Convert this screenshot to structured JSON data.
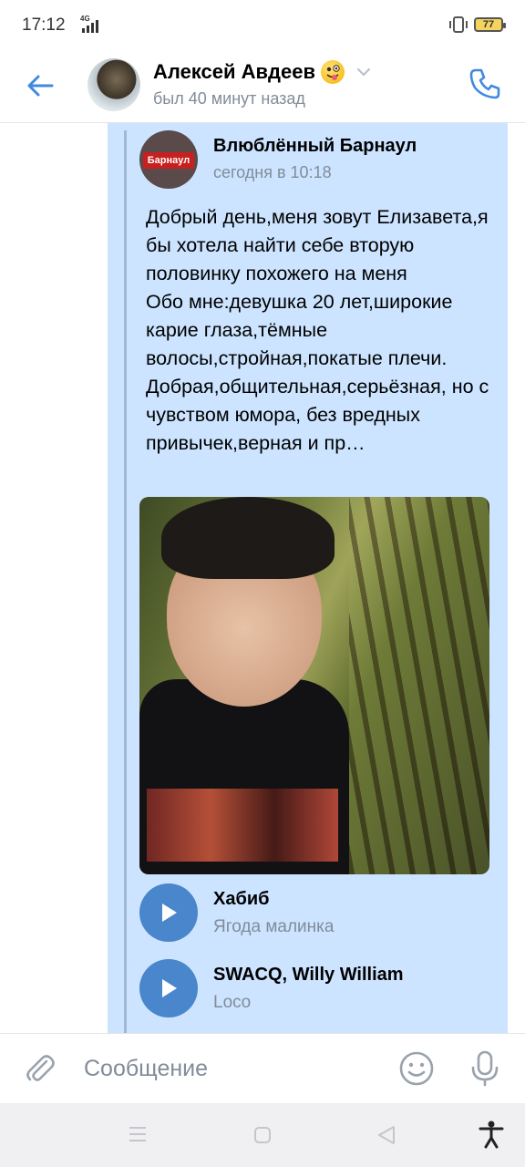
{
  "status_bar": {
    "time": "17:12",
    "network": "4G",
    "battery": "77"
  },
  "header": {
    "contact_name": "Алексей Авдеев",
    "last_seen": "был 40 минут назад"
  },
  "post": {
    "author": "Влюблённый Барнаул",
    "logo_text": "Барнаул",
    "time": "сегодня в 10:18",
    "text": "Добрый день,меня зовут Елизавета,я бы хотела найти себе вторую половинку похожего на меня\nОбо мне:девушка 20 лет,широкие карие глаза,тёмные волосы,стройная,покатые плечи. Добрая,общительная,серьёзная, но с чувством юмора, без вредных привычек,верная и пр…"
  },
  "audio": [
    {
      "title": "Хабиб",
      "artist": "Ягода малинка"
    },
    {
      "title": "SWACQ, Willy William",
      "artist": "Loco"
    }
  ],
  "composer": {
    "placeholder": "Сообщение"
  },
  "colors": {
    "accent": "#4986cc",
    "bubble": "#cce4ff",
    "secondary_text": "#818c99"
  }
}
